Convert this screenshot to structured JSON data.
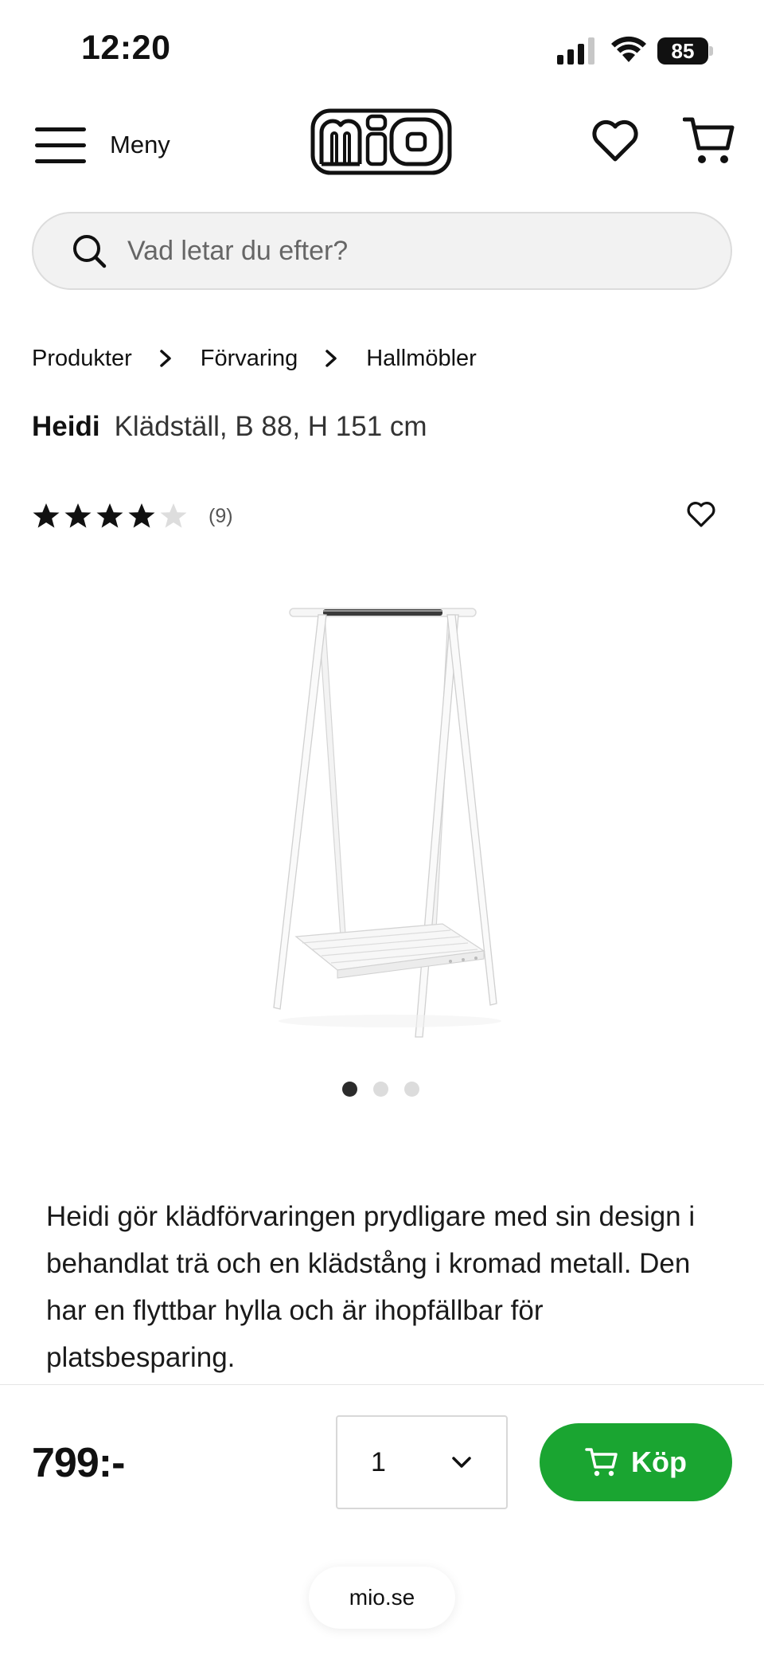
{
  "status_bar": {
    "time": "12:20",
    "battery_level": "85",
    "icons": [
      "signal-icon",
      "wifi-icon",
      "battery-icon"
    ]
  },
  "header": {
    "menu_label": "Meny",
    "logo_text": "mio",
    "icons": [
      "menu-icon",
      "heart-icon",
      "cart-icon"
    ]
  },
  "search": {
    "placeholder": "Vad letar du efter?"
  },
  "breadcrumb": {
    "items": [
      "Produkter",
      "Förvaring",
      "Hallmöbler"
    ]
  },
  "product": {
    "brand": "Heidi",
    "name": "Klädställ, B 88, H 151 cm",
    "rating": 4.5,
    "rating_count": "(9)",
    "image_count": 3,
    "active_image": 1,
    "description": "Heidi gör klädförvaringen prydligare med sin design i behandlat trä och en klädstång i kromad metall. Den har en flyttbar hylla och är ihopfällbar för platsbesparing."
  },
  "purchase": {
    "price": "799:-",
    "quantity": "1",
    "buy_label": "Köp"
  },
  "browser": {
    "url": "mio.se"
  },
  "colors": {
    "buy_button": "#1aa531",
    "search_background": "#f2f2f2"
  }
}
